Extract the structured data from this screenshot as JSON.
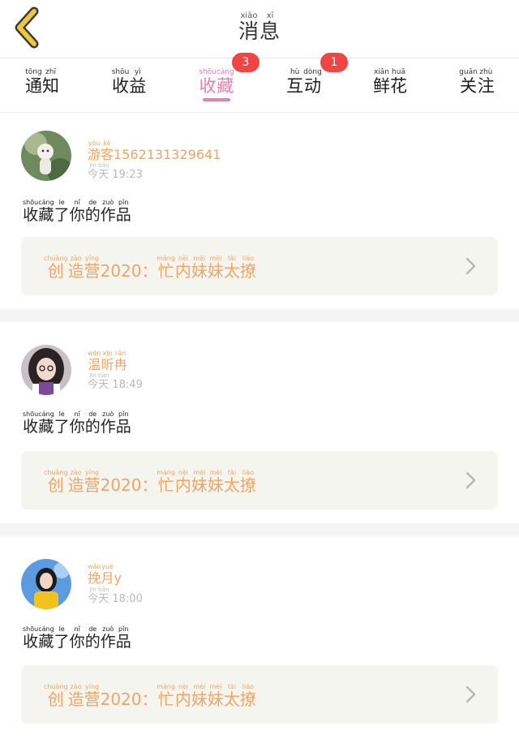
{
  "header": {
    "title": [
      {
        "c": "消",
        "p": "xiāo"
      },
      {
        "c": "息",
        "p": "xī"
      }
    ]
  },
  "tabs": [
    {
      "name": "notice",
      "chars": [
        {
          "c": "通",
          "p": "tōng"
        },
        {
          "c": "知",
          "p": "zhī"
        }
      ]
    },
    {
      "name": "earnings",
      "chars": [
        {
          "c": "收",
          "p": "shōu"
        },
        {
          "c": "益",
          "p": "yì"
        }
      ]
    },
    {
      "name": "favorites",
      "active": true,
      "badge": "3",
      "chars": [
        {
          "c": "收",
          "p": "shōu"
        },
        {
          "c": "藏",
          "p": "cáng"
        }
      ]
    },
    {
      "name": "interaction",
      "badge": "1",
      "chars": [
        {
          "c": "互",
          "p": "hù"
        },
        {
          "c": "动",
          "p": "dòng"
        }
      ]
    },
    {
      "name": "flowers",
      "chars": [
        {
          "c": "鲜",
          "p": "xiān"
        },
        {
          "c": "花",
          "p": "huā"
        }
      ]
    },
    {
      "name": "follow",
      "chars": [
        {
          "c": "关",
          "p": "guān"
        },
        {
          "c": "注",
          "p": "zhù"
        }
      ]
    }
  ],
  "messages": [
    {
      "user": [
        {
          "c": "游",
          "p": "yóu"
        },
        {
          "c": "客",
          "p": "kè"
        },
        {
          "c": "1562131329641",
          "p": ""
        }
      ],
      "day": [
        {
          "c": "今",
          "p": "jīn"
        },
        {
          "c": "天",
          "p": "tiān"
        }
      ],
      "time": "19:23",
      "action": [
        {
          "c": "收",
          "p": "shōu"
        },
        {
          "c": "藏",
          "p": "cáng"
        },
        {
          "c": "了",
          "p": "le"
        },
        {
          "c": "你",
          "p": "nǐ"
        },
        {
          "c": "的",
          "p": "de"
        },
        {
          "c": "作",
          "p": "zuò"
        },
        {
          "c": "品",
          "p": "pǐn"
        }
      ],
      "work": [
        {
          "c": "创",
          "p": "chuàng"
        },
        {
          "c": "造",
          "p": "zào"
        },
        {
          "c": "营",
          "p": "yíng"
        },
        {
          "c": "2020：",
          "p": ""
        },
        {
          "c": "忙",
          "p": "máng"
        },
        {
          "c": "内",
          "p": "nèi"
        },
        {
          "c": "妹",
          "p": "mèi"
        },
        {
          "c": "妹",
          "p": "mèi"
        },
        {
          "c": "太",
          "p": "tài"
        },
        {
          "c": "撩",
          "p": "liáo"
        }
      ]
    },
    {
      "user": [
        {
          "c": "温",
          "p": "wēn"
        },
        {
          "c": "昕",
          "p": "xīn"
        },
        {
          "c": "冉",
          "p": "rǎn"
        }
      ],
      "day": [
        {
          "c": "今",
          "p": "jīn"
        },
        {
          "c": "天",
          "p": "tiān"
        }
      ],
      "time": "18:49",
      "action": [
        {
          "c": "收",
          "p": "shōu"
        },
        {
          "c": "藏",
          "p": "cáng"
        },
        {
          "c": "了",
          "p": "le"
        },
        {
          "c": "你",
          "p": "nǐ"
        },
        {
          "c": "的",
          "p": "de"
        },
        {
          "c": "作",
          "p": "zuò"
        },
        {
          "c": "品",
          "p": "pǐn"
        }
      ],
      "work": [
        {
          "c": "创",
          "p": "chuàng"
        },
        {
          "c": "造",
          "p": "zào"
        },
        {
          "c": "营",
          "p": "yíng"
        },
        {
          "c": "2020：",
          "p": ""
        },
        {
          "c": "忙",
          "p": "máng"
        },
        {
          "c": "内",
          "p": "nèi"
        },
        {
          "c": "妹",
          "p": "mèi"
        },
        {
          "c": "妹",
          "p": "mèi"
        },
        {
          "c": "太",
          "p": "tài"
        },
        {
          "c": "撩",
          "p": "liáo"
        }
      ]
    },
    {
      "user": [
        {
          "c": "挽",
          "p": "wǎn"
        },
        {
          "c": "月",
          "p": "yuè"
        },
        {
          "c": "y",
          "p": ""
        }
      ],
      "day": [
        {
          "c": "今",
          "p": "jīn"
        },
        {
          "c": "天",
          "p": "tiān"
        }
      ],
      "time": "18:00",
      "action": [
        {
          "c": "收",
          "p": "shōu"
        },
        {
          "c": "藏",
          "p": "cáng"
        },
        {
          "c": "了",
          "p": "le"
        },
        {
          "c": "你",
          "p": "nǐ"
        },
        {
          "c": "的",
          "p": "de"
        },
        {
          "c": "作",
          "p": "zuò"
        },
        {
          "c": "品",
          "p": "pǐn"
        }
      ],
      "work": [
        {
          "c": "创",
          "p": "chuàng"
        },
        {
          "c": "造",
          "p": "zào"
        },
        {
          "c": "营",
          "p": "yíng"
        },
        {
          "c": "2020：",
          "p": ""
        },
        {
          "c": "忙",
          "p": "máng"
        },
        {
          "c": "内",
          "p": "nèi"
        },
        {
          "c": "妹",
          "p": "mèi"
        },
        {
          "c": "妹",
          "p": "mèi"
        },
        {
          "c": "太",
          "p": "tài"
        },
        {
          "c": "撩",
          "p": "liáo"
        }
      ]
    }
  ],
  "colors": {
    "accent_pink": "#e87fb4",
    "badge_red": "#f04545",
    "name_orange": "#f0a566",
    "back_yellow": "#f2c63a"
  },
  "icons": {
    "back": "chevron-left-icon",
    "item_arrow": "chevron-right-icon"
  }
}
